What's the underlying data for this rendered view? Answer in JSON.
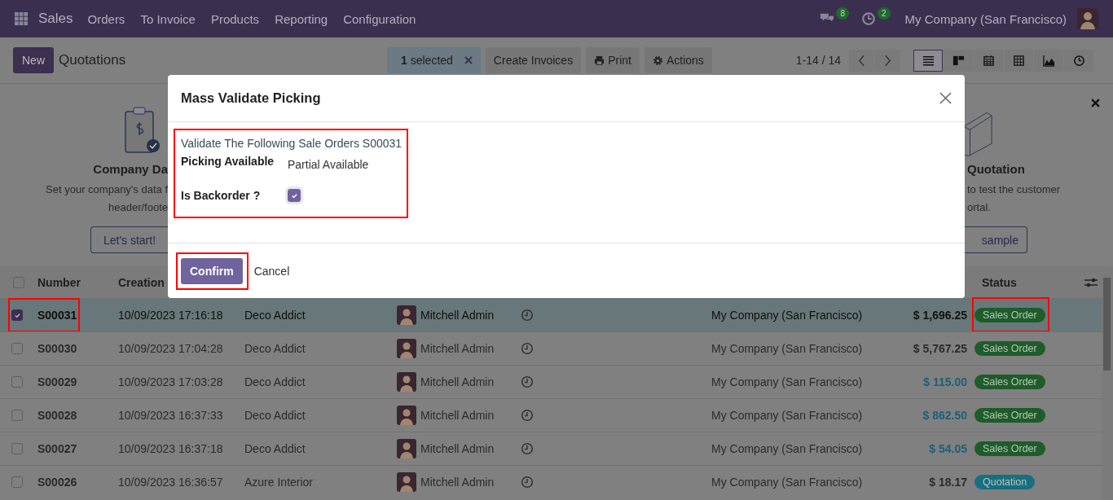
{
  "navbar": {
    "app_name": "Sales",
    "menu": [
      "Orders",
      "To Invoice",
      "Products",
      "Reporting",
      "Configuration"
    ],
    "messages_count": "8",
    "activities_count": "2",
    "company": "My Company (San Francisco)"
  },
  "control_panel": {
    "new_button": "New",
    "title": "Quotations",
    "selection": "**1** selected",
    "actions": [
      {
        "label": "Create Invoices",
        "kind": "plain"
      },
      {
        "label": "Print",
        "kind": "print"
      },
      {
        "label": "Actions",
        "kind": "menu"
      }
    ],
    "pager": "1-14 / 14",
    "views": [
      {
        "kind": "list",
        "selected": true
      },
      {
        "kind": "kanban",
        "selected": false
      },
      {
        "kind": "calendar",
        "selected": false
      },
      {
        "kind": "pivot",
        "selected": false
      },
      {
        "kind": "graph",
        "selected": false
      },
      {
        "kind": "activity",
        "selected": false
      }
    ]
  },
  "banner": {
    "left": {
      "title": "Company Da",
      "lines": [
        "Set your company's data f",
        "header/foote"
      ],
      "button": "Let's start!"
    },
    "right": {
      "title": "Quotation",
      "lines": [
        "to test the customer",
        "ortal."
      ],
      "button": "sample"
    }
  },
  "table": {
    "select_all_checked": false,
    "columns": [
      "Number",
      "Creation"
    ],
    "status_column": "Status",
    "rows": [
      {
        "selected": true,
        "highlighted": true,
        "number": "S00031",
        "date": "10/09/2023 17:16:18",
        "customer": "Deco Addict",
        "salesperson": "Mitchell Admin",
        "company": "My Company (San Francisco)",
        "amount": {
          "kind": "plain",
          "text": "$ 1,696.25"
        },
        "status": {
          "kind": "sale",
          "text": "Sales Order"
        }
      },
      {
        "selected": false,
        "highlighted": false,
        "number": "S00030",
        "date": "10/09/2023 17:04:28",
        "customer": "Deco Addict",
        "salesperson": "Mitchell Admin",
        "company": "My Company (San Francisco)",
        "amount": {
          "kind": "plain",
          "text": "$ 5,767.25"
        },
        "status": {
          "kind": "sale",
          "text": "Sales Order"
        }
      },
      {
        "selected": false,
        "highlighted": false,
        "number": "S00029",
        "date": "10/09/2023 17:03:28",
        "customer": "Deco Addict",
        "salesperson": "Mitchell Admin",
        "company": "My Company (San Francisco)",
        "amount": {
          "kind": "accent",
          "text": "$ 115.00"
        },
        "status": {
          "kind": "sale",
          "text": "Sales Order"
        }
      },
      {
        "selected": false,
        "highlighted": false,
        "number": "S00028",
        "date": "10/09/2023 16:37:33",
        "customer": "Deco Addict",
        "salesperson": "Mitchell Admin",
        "company": "My Company (San Francisco)",
        "amount": {
          "kind": "accent",
          "text": "$ 862.50"
        },
        "status": {
          "kind": "sale",
          "text": "Sales Order"
        }
      },
      {
        "selected": false,
        "highlighted": false,
        "number": "S00027",
        "date": "10/09/2023 16:37:18",
        "customer": "Deco Addict",
        "salesperson": "Mitchell Admin",
        "company": "My Company (San Francisco)",
        "amount": {
          "kind": "accent",
          "text": "$ 54.05"
        },
        "status": {
          "kind": "sale",
          "text": "Sales Order"
        }
      },
      {
        "selected": false,
        "highlighted": false,
        "number": "S00026",
        "date": "10/09/2023 16:36:57",
        "customer": "Azure Interior",
        "salesperson": "Mitchell Admin",
        "company": "My Company (San Francisco)",
        "amount": {
          "kind": "plain",
          "text": "$ 18.17"
        },
        "status": {
          "kind": "quotation",
          "text": "Quotation"
        }
      }
    ]
  },
  "dialog": {
    "title": "Mass Validate Picking",
    "intro": "Validate The Following Sale Orders S00031",
    "fields_highlighted": true,
    "fields": [
      {
        "kind": "text",
        "label": "Picking Available",
        "value": "Partial Available"
      },
      {
        "kind": "checkbox",
        "label": "Is Backorder ?",
        "checked": true
      }
    ],
    "buttons": [
      {
        "kind": "primary",
        "label": "Confirm",
        "highlighted": true
      },
      {
        "kind": "secondary",
        "label": "Cancel",
        "highlighted": false
      }
    ]
  }
}
